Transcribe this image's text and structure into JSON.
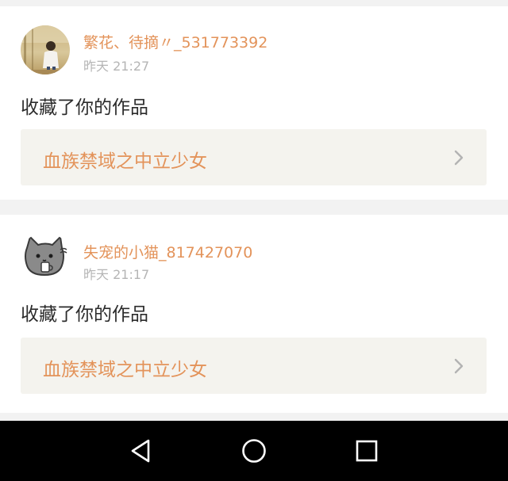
{
  "notifications": [
    {
      "username": "繁花、待摘〃_531773392",
      "time": "昨天 21:27",
      "action": "收藏了你的作品",
      "work_title": "血族禁域之中立少女",
      "avatar_icon": "user-photo-avatar"
    },
    {
      "username": "失宠的小猫_817427070",
      "time": "昨天 21:17",
      "action": "收藏了你的作品",
      "work_title": "血族禁域之中立少女",
      "avatar_icon": "gray-cat-avatar"
    }
  ],
  "navbar": {
    "back_icon": "triangle-back-icon",
    "home_icon": "circle-home-icon",
    "recent_icon": "square-recents-icon"
  },
  "colors": {
    "accent": "#e3935a",
    "time": "#b5b5b5",
    "work_box_bg": "#f4f3ee",
    "feed_bg": "#f2f2f2"
  }
}
